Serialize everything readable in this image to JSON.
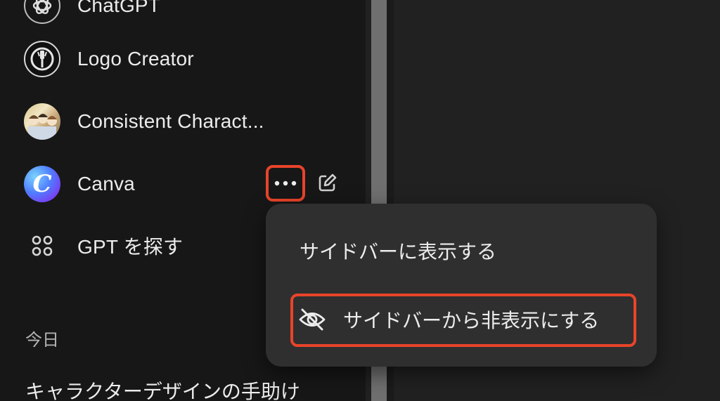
{
  "sidebar": {
    "items": [
      {
        "label": "ChatGPT",
        "icon": "openai-logo-icon"
      },
      {
        "label": "Logo Creator",
        "icon": "logo-creator-avatar"
      },
      {
        "label": "Consistent Charact...",
        "icon": "consistent-character-avatar"
      },
      {
        "label": "Canva",
        "icon": "canva-avatar",
        "avatar_letter": "C"
      },
      {
        "label": "GPT を探す",
        "icon": "grid-dots-icon"
      }
    ],
    "section_title": "今日",
    "history": [
      "キャラクターデザインの手助け"
    ]
  },
  "menu": {
    "items": [
      {
        "label": "サイドバーに表示する"
      },
      {
        "label": "サイドバーから非表示にする",
        "icon": "eye-off-icon"
      }
    ]
  },
  "colors": {
    "highlight": "#e8442a",
    "sidebar_bg": "#171717",
    "main_bg": "#212121",
    "menu_bg": "#2f2f2f"
  }
}
